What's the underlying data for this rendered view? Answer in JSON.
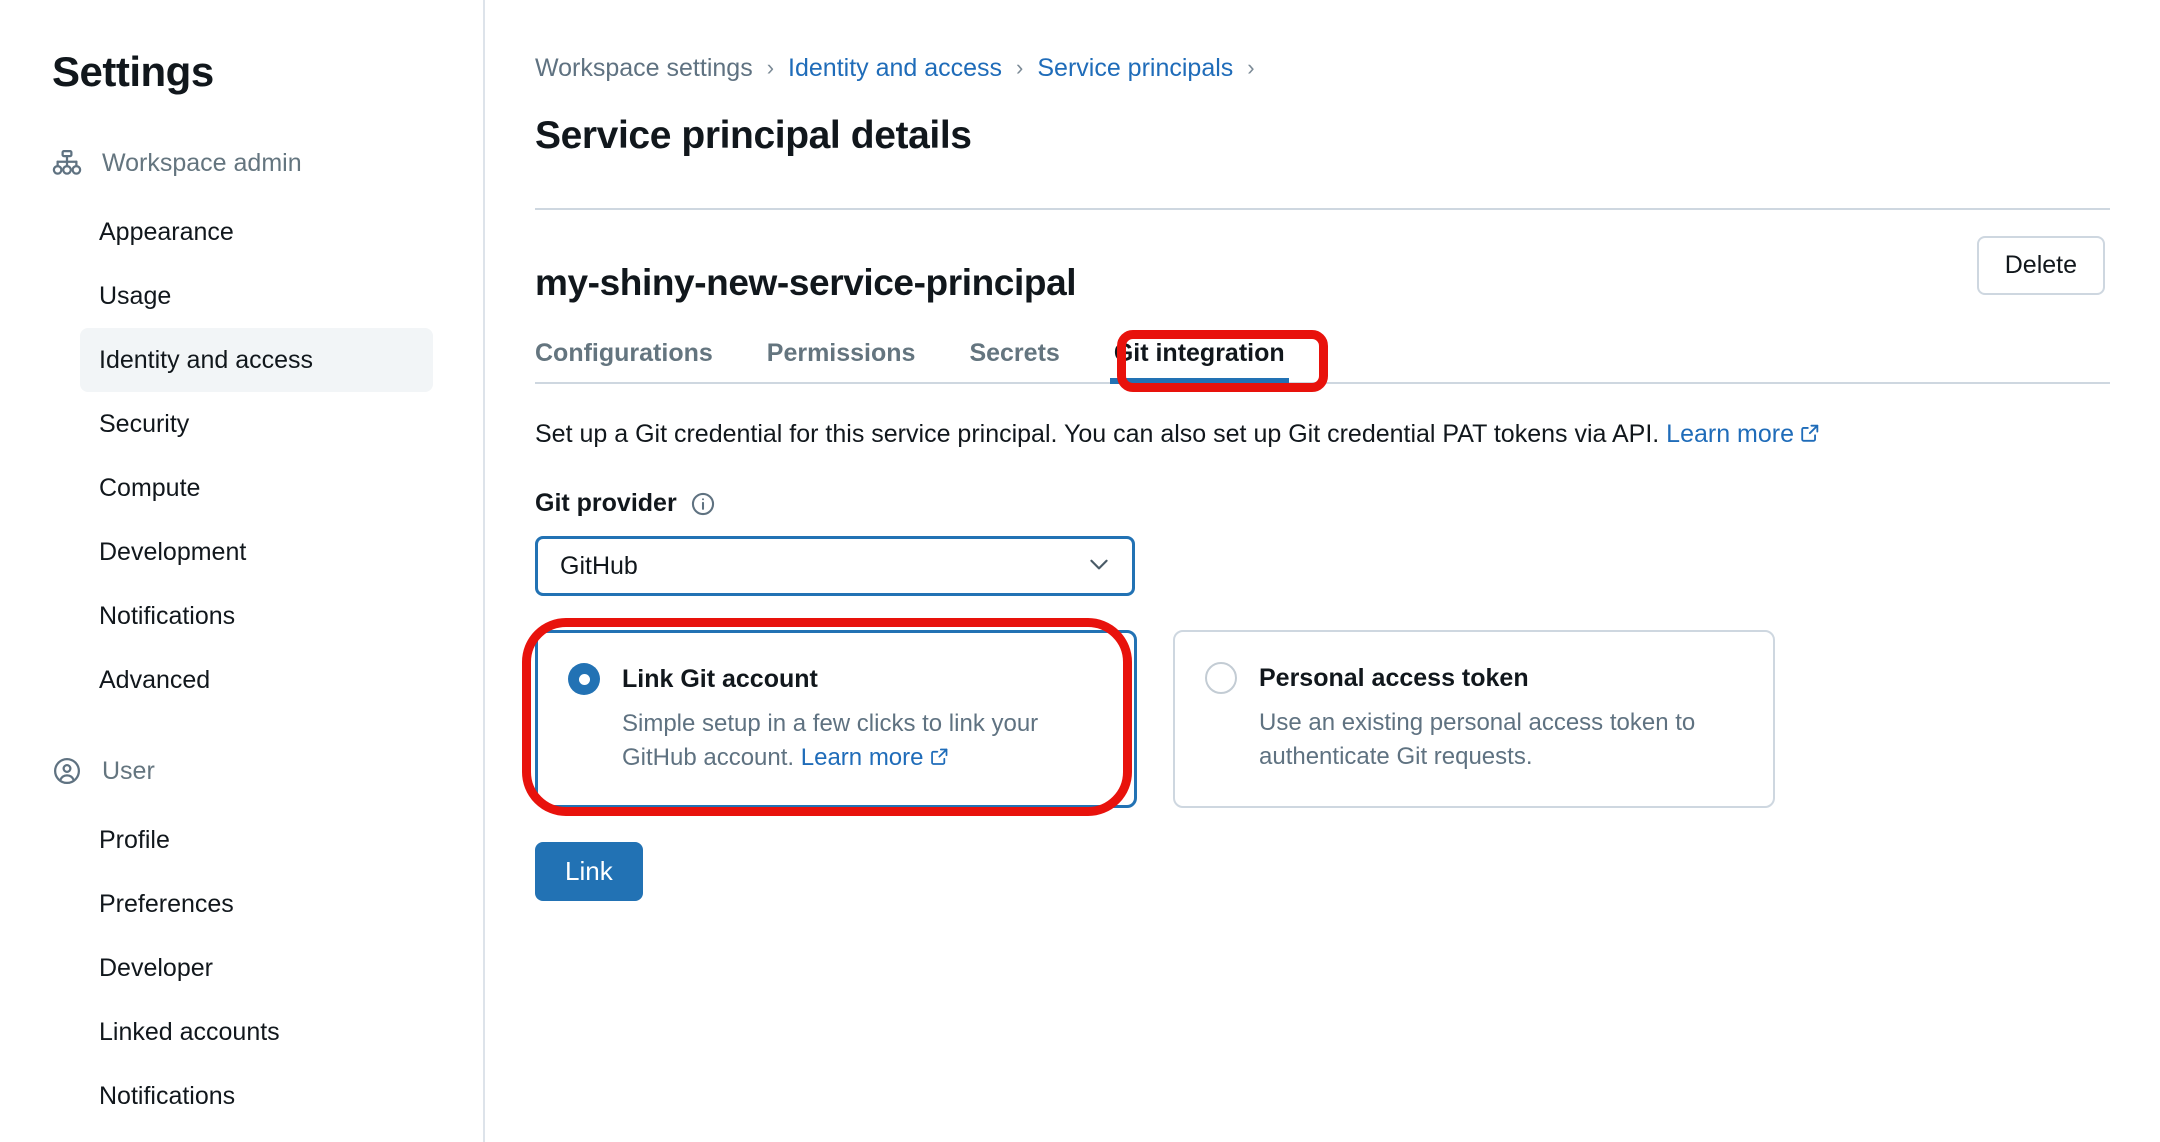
{
  "sidebar": {
    "title": "Settings",
    "groups": [
      {
        "name": "workspace-admin",
        "icon": "org-chart-icon",
        "label": "Workspace admin",
        "items": [
          {
            "label": "Appearance",
            "active": false
          },
          {
            "label": "Usage",
            "active": false
          },
          {
            "label": "Identity and access",
            "active": true
          },
          {
            "label": "Security",
            "active": false
          },
          {
            "label": "Compute",
            "active": false
          },
          {
            "label": "Development",
            "active": false
          },
          {
            "label": "Notifications",
            "active": false
          },
          {
            "label": "Advanced",
            "active": false
          }
        ]
      },
      {
        "name": "user",
        "icon": "user-circle-icon",
        "label": "User",
        "items": [
          {
            "label": "Profile",
            "active": false
          },
          {
            "label": "Preferences",
            "active": false
          },
          {
            "label": "Developer",
            "active": false
          },
          {
            "label": "Linked accounts",
            "active": false
          },
          {
            "label": "Notifications",
            "active": false
          }
        ]
      }
    ]
  },
  "breadcrumb": {
    "items": [
      {
        "label": "Workspace settings",
        "link": false
      },
      {
        "label": "Identity and access",
        "link": true
      },
      {
        "label": "Service principals",
        "link": true
      }
    ],
    "separator": "›",
    "trailing_separator": "›"
  },
  "header": {
    "page_title": "Service principal details"
  },
  "entity": {
    "name": "my-shiny-new-service-principal",
    "delete_label": "Delete"
  },
  "tabs": [
    {
      "label": "Configurations",
      "active": false
    },
    {
      "label": "Permissions",
      "active": false
    },
    {
      "label": "Secrets",
      "active": false
    },
    {
      "label": "Git integration",
      "active": true
    }
  ],
  "git_integration": {
    "description_text": "Set up a Git credential for this service principal. You can also set up Git credential PAT tokens via API.",
    "description_link": "Learn more",
    "provider_label": "Git provider",
    "provider_info_icon": "info-circle-icon",
    "provider_value": "GitHub",
    "provider_chevron_icon": "chevron-down-icon",
    "options": [
      {
        "title": "Link Git account",
        "description": "Simple setup in a few clicks to link your GitHub account.",
        "link": "Learn more",
        "selected": true
      },
      {
        "title": "Personal access token",
        "description": "Use an existing personal access token to authenticate Git requests.",
        "link": "",
        "selected": false
      }
    ],
    "submit_label": "Link"
  },
  "colors": {
    "accent_blue": "#2272b4",
    "link_blue": "#1f6cb9",
    "annotation_red": "#e8120c",
    "text_primary": "#11171c",
    "text_muted": "#5f7281",
    "border": "#ced7e0",
    "active_nav_bg": "#f2f5f7"
  },
  "annotations": [
    {
      "target": "tab-git-integration",
      "shape": "rounded-rect",
      "color": "#e8120c"
    },
    {
      "target": "option-card-link-git-account",
      "shape": "rounded-rect",
      "color": "#e8120c"
    }
  ]
}
